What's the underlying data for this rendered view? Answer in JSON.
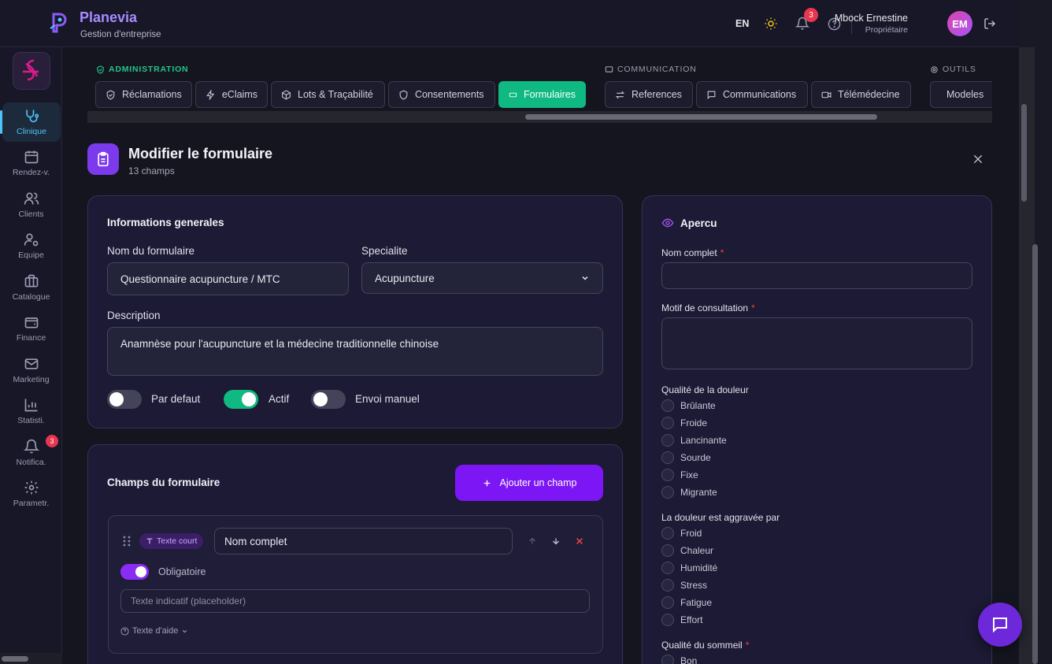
{
  "header": {
    "brand": "Planevia",
    "subtitle": "Gestion d'entreprise",
    "lang": "EN",
    "notif_count": "3",
    "user_name": "Mbock Ernestine",
    "user_role": "Propriétaire",
    "avatar_initials": "EM"
  },
  "sidebar": {
    "items": [
      {
        "label": "Clinique",
        "icon": "stethoscope-icon"
      },
      {
        "label": "Rendez-v.",
        "icon": "calendar-icon"
      },
      {
        "label": "Clients",
        "icon": "users-icon"
      },
      {
        "label": "Equipe",
        "icon": "user-cog-icon"
      },
      {
        "label": "Catalogue",
        "icon": "briefcase-icon"
      },
      {
        "label": "Finance",
        "icon": "wallet-icon"
      },
      {
        "label": "Marketing",
        "icon": "mail-icon"
      },
      {
        "label": "Statisti.",
        "icon": "bar-chart-icon"
      },
      {
        "label": "Notifica.",
        "icon": "bell-icon"
      },
      {
        "label": "Parametr.",
        "icon": "gear-icon"
      }
    ],
    "notif_badge": "3"
  },
  "nav": {
    "sections": {
      "admin": "ADMINISTRATION",
      "communication": "COMMUNICATION",
      "tools": "OUTILS"
    },
    "tabs": [
      {
        "label": "Réclamations"
      },
      {
        "label": "eClaims"
      },
      {
        "label": "Lots & Traçabilité"
      },
      {
        "label": "Consentements"
      },
      {
        "label": "Formulaires"
      },
      {
        "label": "References"
      },
      {
        "label": "Communications"
      },
      {
        "label": "Télémédecine"
      },
      {
        "label": "Modeles"
      }
    ]
  },
  "page": {
    "title": "Modifier le formulaire",
    "subtitle": "13 champs"
  },
  "general": {
    "title": "Informations generales",
    "name_label": "Nom du formulaire",
    "name_value": "Questionnaire acupuncture / MTC",
    "specialty_label": "Specialite",
    "specialty_value": "Acupuncture",
    "description_label": "Description",
    "description_value": "Anamnèse pour l'acupuncture et la médecine traditionnelle chinoise",
    "toggles": [
      {
        "label": "Par defaut",
        "on": false
      },
      {
        "label": "Actif",
        "on": true
      },
      {
        "label": "Envoi manuel",
        "on": false
      }
    ]
  },
  "fields": {
    "title": "Champs du formulaire",
    "add_label": "Ajouter un champ",
    "field1": {
      "type": "Texte court",
      "name": "Nom complet",
      "required_label": "Obligatoire",
      "placeholder_hint": "Texte indicatif (placeholder)",
      "help_label": "Texte d'aide"
    }
  },
  "preview": {
    "title": "Apercu",
    "q1": "Nom complet",
    "q2": "Motif de consultation",
    "q3": "Qualité de la douleur",
    "q3_options": [
      "Brûlante",
      "Froide",
      "Lancinante",
      "Sourde",
      "Fixe",
      "Migrante"
    ],
    "q4": "La douleur est aggravée par",
    "q4_options": [
      "Froid",
      "Chaleur",
      "Humidité",
      "Stress",
      "Fatigue",
      "Effort"
    ],
    "q5": "Qualité du sommeil",
    "q5_options": [
      "Bon"
    ],
    "required_mark": "*"
  },
  "colors": {
    "accent": "#7c16f5",
    "active_tab": "#10b981",
    "brand": "#a98bff",
    "admin": "#22c58b"
  }
}
